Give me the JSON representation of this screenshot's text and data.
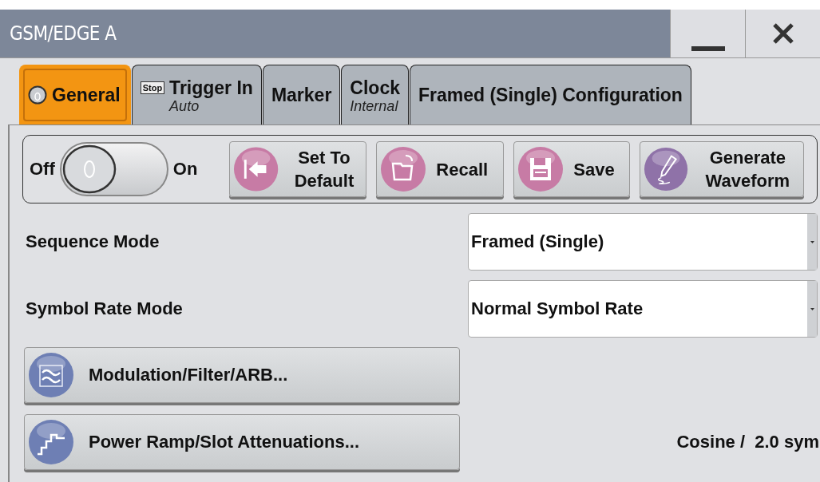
{
  "window": {
    "title": "GSM/EDGE A"
  },
  "tabs": [
    {
      "label": "General",
      "kind": "general",
      "selected": true
    },
    {
      "label": "Trigger In",
      "sub": "Auto",
      "badge": "Stop",
      "kind": "trigger",
      "selected": false
    },
    {
      "label": "Marker",
      "kind": "plain",
      "selected": false
    },
    {
      "label": "Clock",
      "sub": "Internal",
      "kind": "plain",
      "selected": false
    },
    {
      "label": "Framed (Single) Configuration",
      "kind": "plain",
      "selected": false
    }
  ],
  "power": {
    "off_label": "Off",
    "on_label": "On",
    "on": false
  },
  "toolbar": [
    {
      "label": "Set To Default",
      "kind": "default"
    },
    {
      "label": "Recall",
      "kind": "recall"
    },
    {
      "label": "Save",
      "kind": "save"
    },
    {
      "label": "Generate Waveform",
      "kind": "generate"
    }
  ],
  "settings": [
    {
      "label": "Sequence Mode",
      "value": "Framed (Single)"
    },
    {
      "label": "Symbol Rate Mode",
      "value": "Normal Symbol Rate"
    }
  ],
  "dialog_buttons": [
    {
      "label": "Modulation/Filter/ARB...",
      "kind": "filter"
    },
    {
      "label": "Power Ramp/Slot Attenuations...",
      "kind": "ramp",
      "note": "Cosine /  2.0 sym"
    }
  ]
}
